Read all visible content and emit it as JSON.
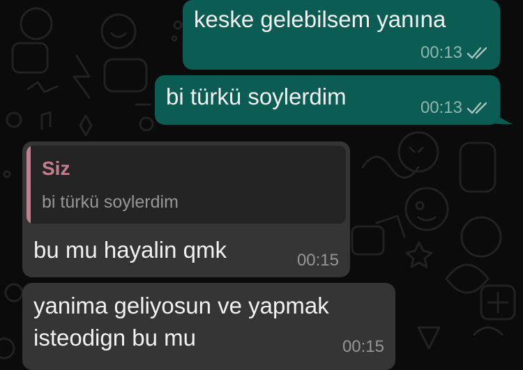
{
  "colors": {
    "background": "#0b0b0b",
    "outgoing_bubble": "#0b5c53",
    "incoming_bubble": "#353535",
    "quote_background": "#242424",
    "quote_accent": "#c2808f",
    "read_ticks": "#a9c4c0"
  },
  "messages": [
    {
      "direction": "outgoing",
      "text": "keske gelebilsem yanına",
      "time": "00:13",
      "status_icon": "double-check-icon"
    },
    {
      "direction": "outgoing",
      "text": "bi türkü soylerdim",
      "time": "00:13",
      "status_icon": "double-check-icon"
    },
    {
      "direction": "incoming",
      "reply_to": {
        "author": "Siz",
        "text": "bi türkü soylerdim"
      },
      "text": "bu mu hayalin qmk",
      "time": "00:15"
    },
    {
      "direction": "incoming",
      "lines": [
        "yanima geliyosun ve yapmak",
        "isteodign bu mu"
      ],
      "time": "00:15"
    }
  ]
}
